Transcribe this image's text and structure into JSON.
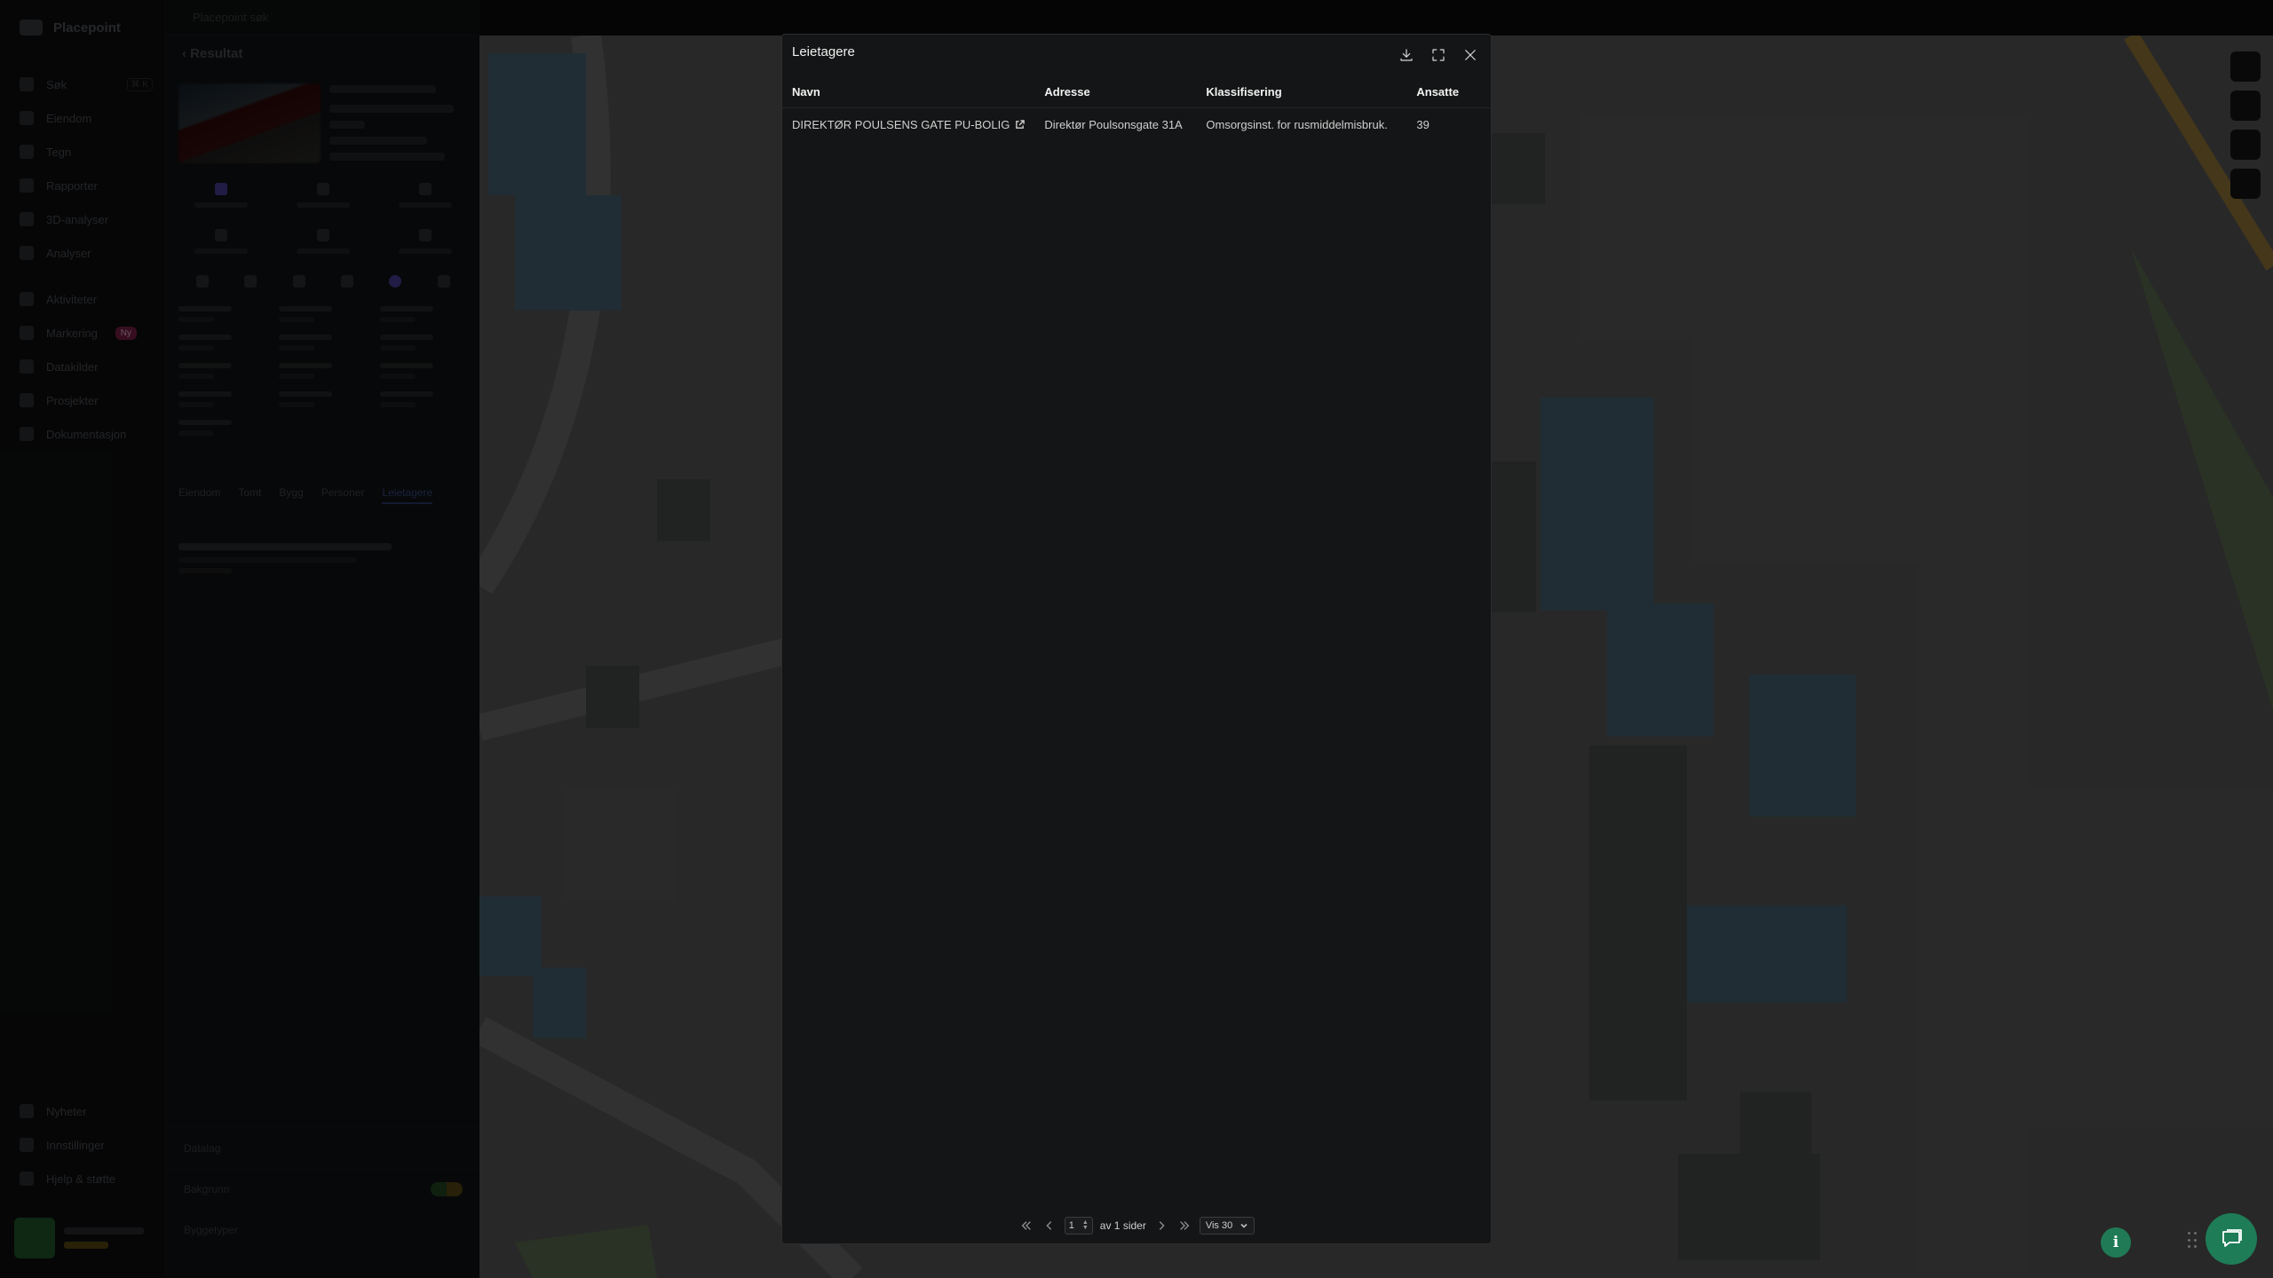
{
  "app": {
    "brand": "Placepoint"
  },
  "sidebar": {
    "items": [
      {
        "label": "Søk",
        "shortcut": "⌘ K",
        "icon": "search-icon"
      },
      {
        "label": "Eiendom",
        "icon": "building-icon"
      },
      {
        "label": "Tegn",
        "icon": "pen-icon"
      },
      {
        "label": "Rapporter",
        "icon": "report-icon"
      },
      {
        "label": "3D-analyser",
        "icon": "cube-icon"
      },
      {
        "label": "Analyser",
        "icon": "chart-icon"
      },
      {
        "label": "Aktiviteter",
        "icon": "activity-icon"
      },
      {
        "label": "Markering",
        "badge": "Ny",
        "icon": "marker-icon"
      },
      {
        "label": "Datakilder",
        "icon": "database-icon"
      },
      {
        "label": "Prosjekter",
        "icon": "folder-icon"
      },
      {
        "label": "Dokumentasjon",
        "icon": "doc-icon"
      }
    ],
    "bottom": [
      {
        "label": "Nyheter",
        "icon": "news-icon"
      },
      {
        "label": "Innstillinger",
        "icon": "gear-icon"
      },
      {
        "label": "Hjelp & støtte",
        "icon": "help-icon"
      }
    ]
  },
  "panel": {
    "search_placeholder": "Placepoint søk",
    "back_label": "Resultat",
    "tabs": [
      "Eiendom",
      "Tomt",
      "Bygg",
      "Personer",
      "Leietagere"
    ],
    "bottom_rows": [
      "Datalag",
      "Bakgrunn",
      "Byggetyper"
    ]
  },
  "modal": {
    "title": "Leietagere",
    "actions": {
      "download": "download-icon",
      "expand": "expand-icon",
      "close": "close-icon"
    },
    "columns": [
      "Navn",
      "Adresse",
      "Klassifisering",
      "Ansatte"
    ],
    "rows": [
      {
        "navn": "DIREKTØR POULSENS GATE PU-BOLIG",
        "adresse": "Direktør Poulsonsgate 31A",
        "klassifisering": "Omsorgsinst. for rusmiddelmisbruk.",
        "ansatte": "39"
      }
    ],
    "pagination": {
      "page": "1",
      "of_label": "av 1 sider",
      "page_size": "Vis 30"
    }
  },
  "colors": {
    "modal_bg": "#141516",
    "accent_green": "#1e7c57",
    "map_building": "#6f9bb6"
  }
}
